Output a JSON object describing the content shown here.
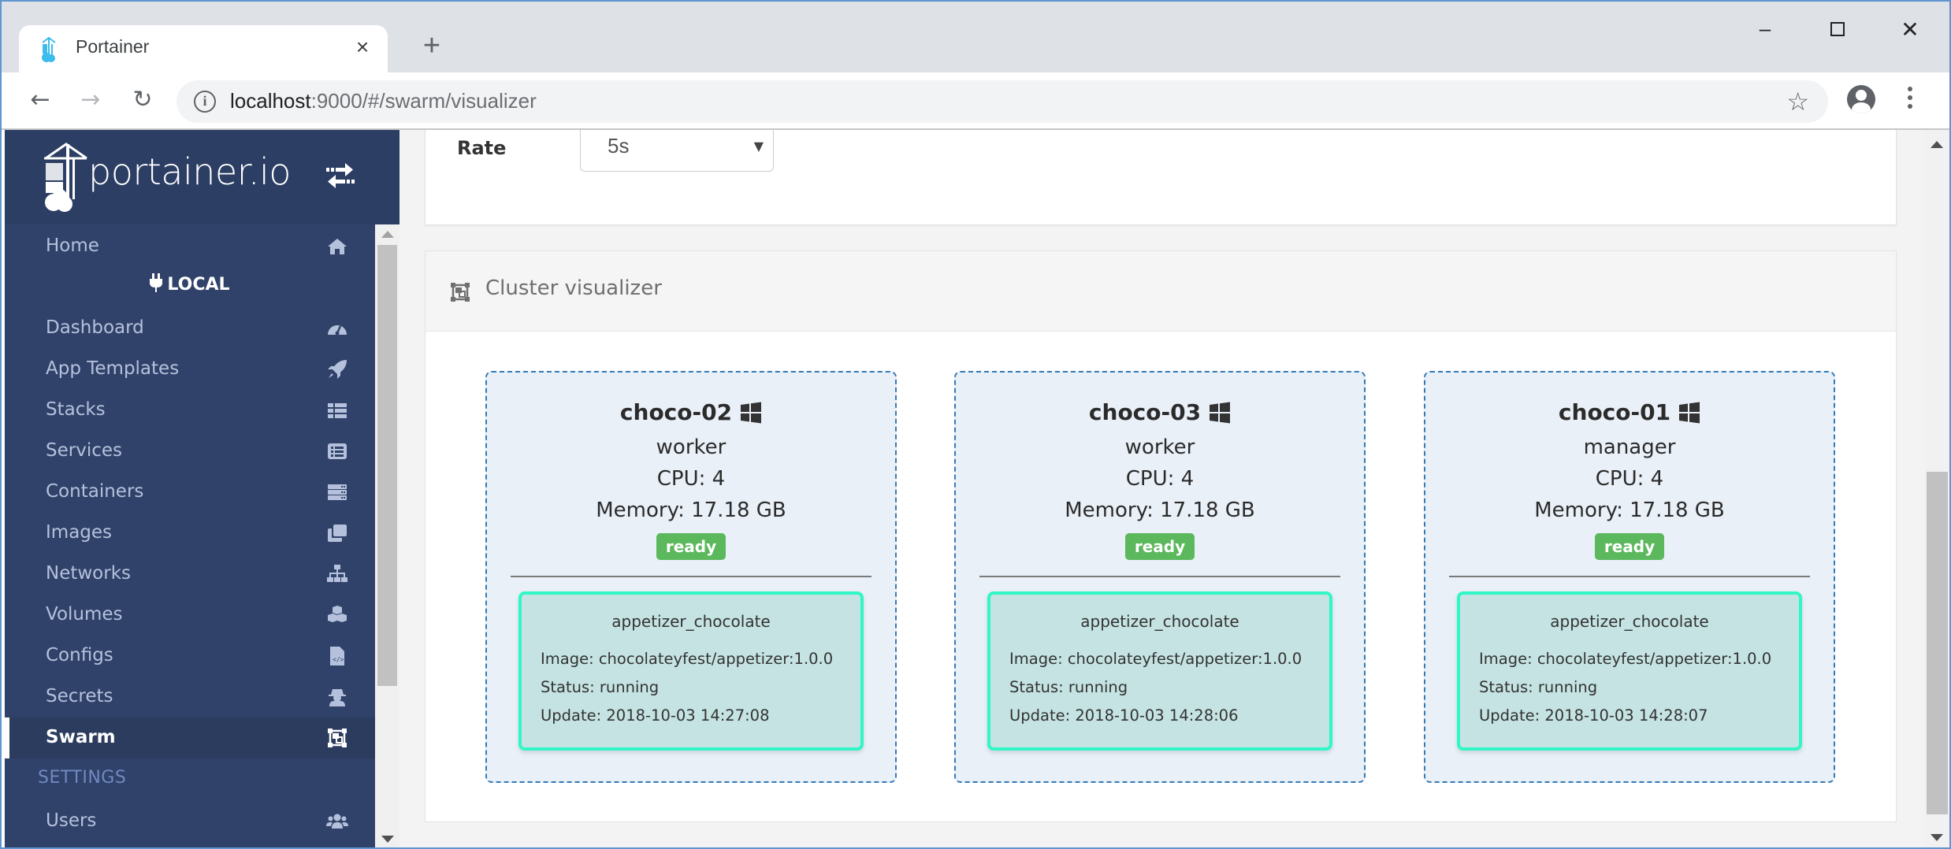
{
  "browser": {
    "tab_title": "Portainer",
    "tab_close": "×",
    "new_tab": "+",
    "window_controls": {
      "minimize": "–",
      "close": "✕"
    },
    "url_host": "localhost",
    "url_rest": ":9000/#/swarm/visualizer",
    "icons": {
      "back": "←",
      "forward": "→",
      "reload": "↻",
      "info": "i",
      "star": "☆"
    }
  },
  "sidebar": {
    "logo_text": "portainer.io",
    "endpoint_label": "LOCAL",
    "settings_heading": "SETTINGS",
    "items": [
      {
        "label": "Home",
        "icon": "home-icon"
      },
      {
        "label": "Dashboard",
        "icon": "tachometer-icon"
      },
      {
        "label": "App Templates",
        "icon": "rocket-icon"
      },
      {
        "label": "Stacks",
        "icon": "th-list-icon"
      },
      {
        "label": "Services",
        "icon": "list-alt-icon"
      },
      {
        "label": "Containers",
        "icon": "server-icon"
      },
      {
        "label": "Images",
        "icon": "clone-icon"
      },
      {
        "label": "Networks",
        "icon": "sitemap-icon"
      },
      {
        "label": "Volumes",
        "icon": "cubes-icon"
      },
      {
        "label": "Configs",
        "icon": "file-code-icon"
      },
      {
        "label": "Secrets",
        "icon": "user-secret-icon"
      },
      {
        "label": "Swarm",
        "icon": "object-group-icon",
        "active": true
      },
      {
        "label": "Users",
        "icon": "users-icon"
      }
    ]
  },
  "main": {
    "rate": {
      "label": "Rate",
      "value": "5s"
    },
    "cluster": {
      "title": "Cluster visualizer",
      "nodes": [
        {
          "name": "choco-02",
          "os_icon": "windows-icon",
          "role": "worker",
          "cpu": "CPU: 4",
          "memory": "Memory: 17.18 GB",
          "status": "ready",
          "task": {
            "service": "appetizer_chocolate",
            "image": "Image: chocolateyfest/appetizer:1.0.0",
            "status": "Status: running",
            "update": "Update: 2018-10-03 14:27:08"
          }
        },
        {
          "name": "choco-03",
          "os_icon": "windows-icon",
          "role": "worker",
          "cpu": "CPU: 4",
          "memory": "Memory: 17.18 GB",
          "status": "ready",
          "task": {
            "service": "appetizer_chocolate",
            "image": "Image: chocolateyfest/appetizer:1.0.0",
            "status": "Status: running",
            "update": "Update: 2018-10-03 14:28:06"
          }
        },
        {
          "name": "choco-01",
          "os_icon": "windows-icon",
          "role": "manager",
          "cpu": "CPU: 4",
          "memory": "Memory: 17.18 GB",
          "status": "ready",
          "task": {
            "service": "appetizer_chocolate",
            "image": "Image: chocolateyfest/appetizer:1.0.0",
            "status": "Status: running",
            "update": "Update: 2018-10-03 14:28:07"
          }
        }
      ]
    }
  },
  "colors": {
    "sidebar_bg": "#30426a",
    "ready_badge": "#5cb85c",
    "node_border": "#337ab7",
    "task_border": "#30f7c5",
    "task_bg": "#c4e3e2"
  }
}
